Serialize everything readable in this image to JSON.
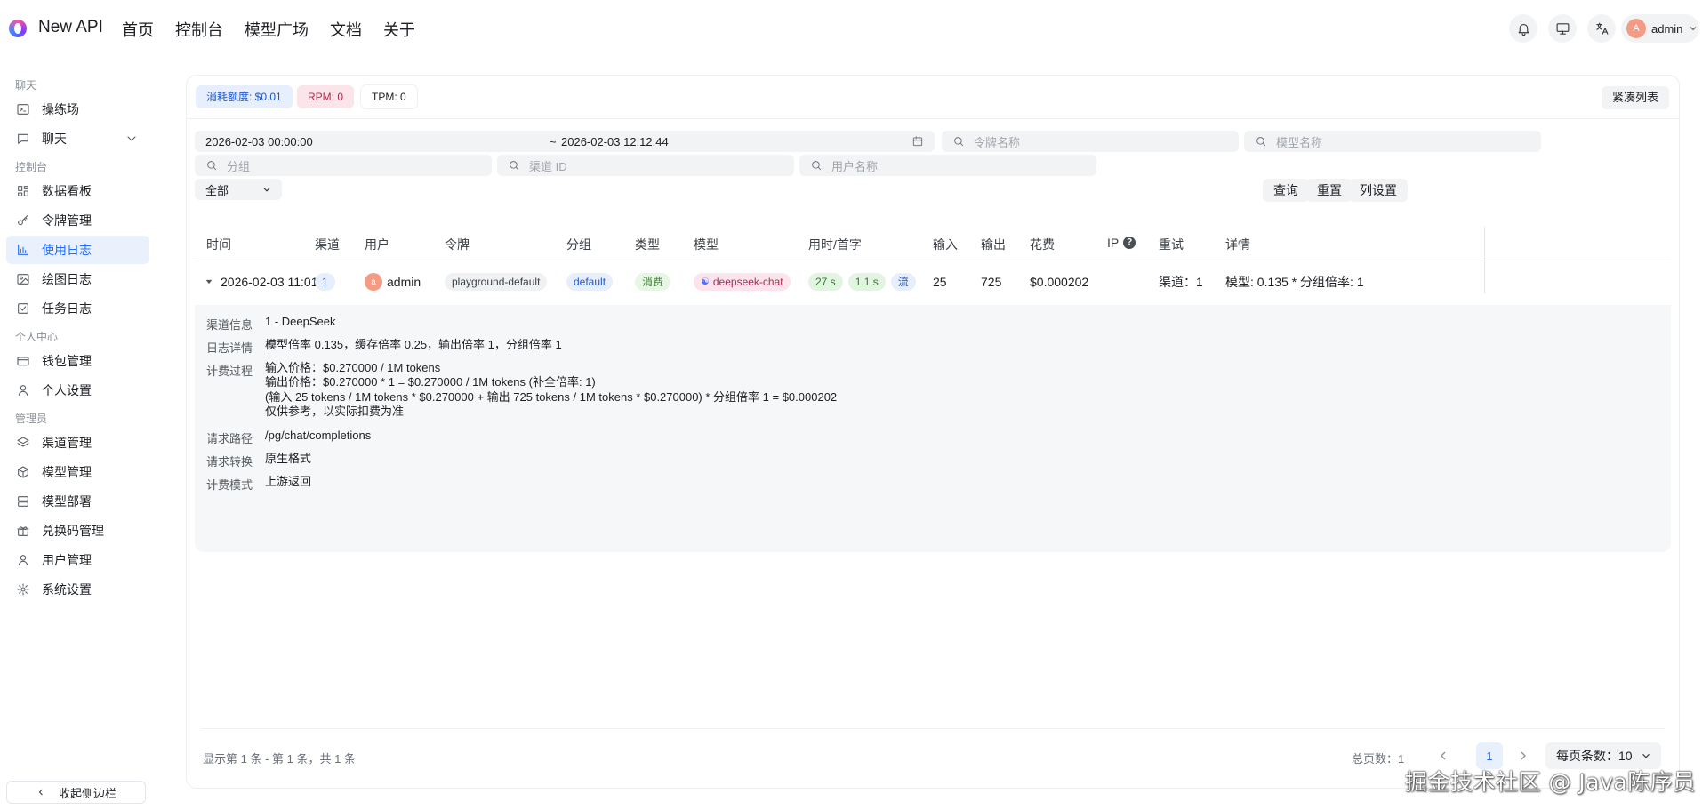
{
  "header": {
    "brand": "New API",
    "nav": [
      "首页",
      "控制台",
      "模型广场",
      "文档",
      "关于"
    ],
    "user_initial": "A",
    "username": "admin"
  },
  "sidebar": {
    "sections": [
      {
        "title": "聊天",
        "items": [
          {
            "label": "操练场",
            "icon": "playground-icon"
          },
          {
            "label": "聊天",
            "icon": "chat-icon"
          }
        ]
      },
      {
        "title": "控制台",
        "items": [
          {
            "label": "数据看板",
            "icon": "dashboard-icon"
          },
          {
            "label": "令牌管理",
            "icon": "key-icon"
          },
          {
            "label": "使用日志",
            "icon": "chart-icon"
          },
          {
            "label": "绘图日志",
            "icon": "image-icon"
          },
          {
            "label": "任务日志",
            "icon": "task-icon"
          }
        ]
      },
      {
        "title": "个人中心",
        "items": [
          {
            "label": "钱包管理",
            "icon": "wallet-icon"
          },
          {
            "label": "个人设置",
            "icon": "user-icon"
          }
        ]
      },
      {
        "title": "管理员",
        "items": [
          {
            "label": "渠道管理",
            "icon": "layers-icon"
          },
          {
            "label": "模型管理",
            "icon": "box-icon"
          },
          {
            "label": "模型部署",
            "icon": "server-icon"
          },
          {
            "label": "兑换码管理",
            "icon": "gift-icon"
          },
          {
            "label": "用户管理",
            "icon": "user-icon"
          },
          {
            "label": "系统设置",
            "icon": "gear-icon"
          }
        ]
      }
    ],
    "active": "使用日志",
    "collapse_label": "收起侧边栏"
  },
  "stats": {
    "quota": "消耗额度: $0.01",
    "rpm": "RPM: 0",
    "tpm": "TPM: 0",
    "compact_label": "紧凑列表"
  },
  "filters": {
    "start_time": "2026-02-03 00:00:00",
    "tilde": "~",
    "end_time": "2026-02-03 12:12:44",
    "token_placeholder": "令牌名称",
    "model_placeholder": "模型名称",
    "group_placeholder": "分组",
    "channel_placeholder": "渠道 ID",
    "user_placeholder": "用户名称",
    "type_value": "全部",
    "query_label": "查询",
    "reset_label": "重置",
    "columns_label": "列设置"
  },
  "table": {
    "headers": [
      "时间",
      "渠道",
      "用户",
      "令牌",
      "分组",
      "类型",
      "模型",
      "用时/首字",
      "输入",
      "输出",
      "花费",
      "IP",
      "重试",
      "详情"
    ],
    "row": {
      "time": "2026-02-03 11:01:34",
      "channel": "1",
      "user_initial": "a",
      "user": "admin",
      "token": "playground-default",
      "group": "default",
      "type": "消费",
      "model": "deepseek-chat",
      "use_time": "27 s",
      "first_token": "1.1 s",
      "stream": "流",
      "input": "25",
      "output": "725",
      "cost": "$0.000202",
      "retry": "渠道：1",
      "detail": "模型: 0.135 * 分组倍率: 1"
    },
    "expanded": [
      {
        "key": "渠道信息",
        "lines": [
          "1 - DeepSeek"
        ]
      },
      {
        "key": "日志详情",
        "lines": [
          "模型倍率 0.135，缓存倍率 0.25，输出倍率 1，分组倍率 1"
        ]
      },
      {
        "key": "计费过程",
        "lines": [
          "输入价格：$0.270000 / 1M tokens",
          "输出价格：$0.270000 * 1 = $0.270000 / 1M tokens (补全倍率: 1)",
          "(输入 25 tokens / 1M tokens * $0.270000 + 输出 725 tokens / 1M tokens * $0.270000) * 分组倍率 1 = $0.000202",
          "仅供参考，以实际扣费为准"
        ]
      },
      {
        "key": "请求路径",
        "lines": [
          "/pg/chat/completions"
        ]
      },
      {
        "key": "请求转换",
        "lines": [
          "原生格式"
        ]
      },
      {
        "key": "计费模式",
        "lines": [
          "上游返回"
        ]
      }
    ]
  },
  "footer": {
    "info": "显示第 1 条 - 第 1 条，共 1 条",
    "total_pages": "总页数：1",
    "current_page": "1",
    "per_page": "每页条数：10"
  },
  "watermark": "掘金技术社区 @ Java陈序员"
}
